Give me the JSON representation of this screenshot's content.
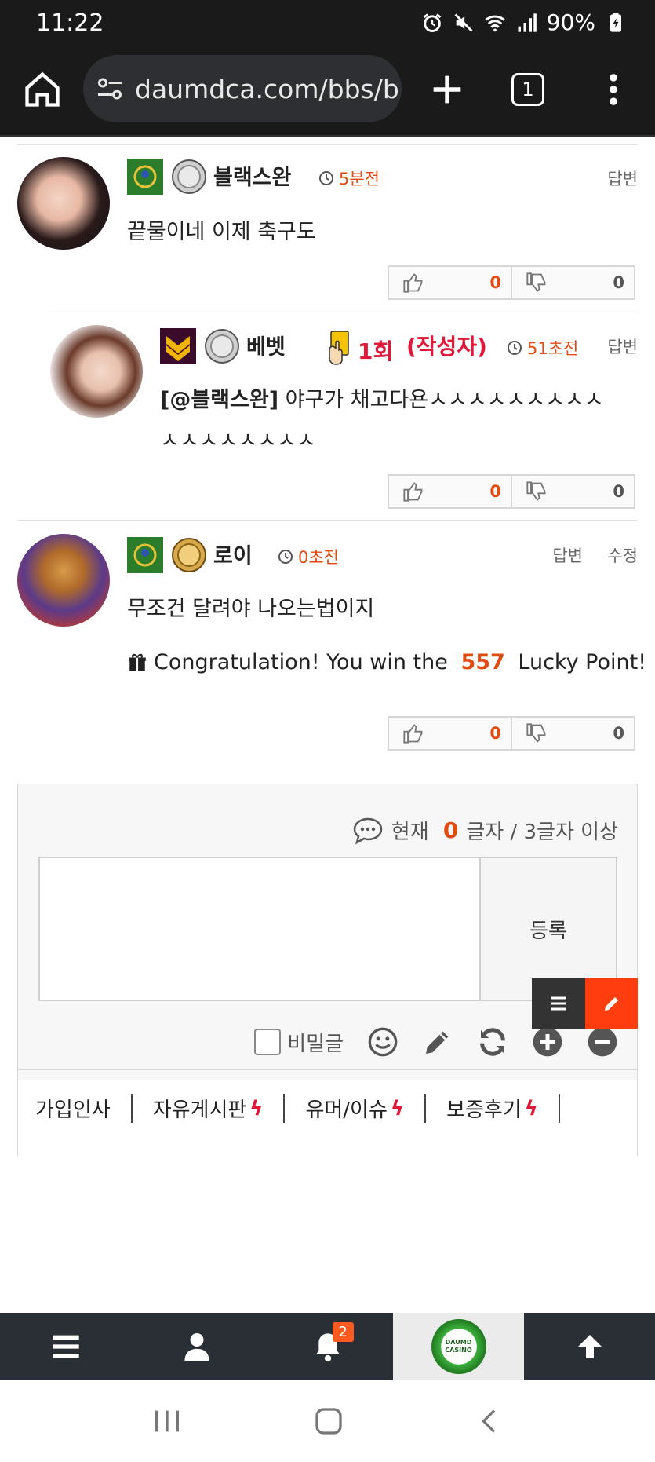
{
  "status_bar": {
    "time": "11:22",
    "battery": "90%"
  },
  "browser": {
    "url": "daumdca.com/bbs/b",
    "tab_count": "1"
  },
  "comments": [
    {
      "nickname": "블랙스완",
      "time_ago": "5분전",
      "text": "끝물이네 이제 축구도",
      "actions": [
        "답변"
      ],
      "likes": "0",
      "dislikes": "0"
    },
    {
      "nickname": "베벳",
      "warning": "1회",
      "author_tag": "(작성자)",
      "time_ago": "51초전",
      "mention": "[@블랙스완]",
      "text_line1": " 야구가 채고다욘ㅅㅅㅅㅅㅅㅅㅅㅅㅅ",
      "text_line2": "ㅅㅅㅅㅅㅅㅅㅅㅅ",
      "actions": [
        "답변"
      ],
      "likes": "0",
      "dislikes": "0"
    },
    {
      "nickname": "로이",
      "time_ago": "0초전",
      "text": "무조건 달려야 나오는법이지",
      "actions": [
        "답변",
        "수정"
      ],
      "lucky_prefix": "Congratulation! You win the ",
      "lucky_points": "557",
      "lucky_suffix": " Lucky Point!",
      "likes": "0",
      "dislikes": "0"
    }
  ],
  "editor": {
    "counter_prefix": "현재 ",
    "counter_value": "0",
    "counter_suffix": "글자 / 3글자 이상",
    "submit_label": "등록",
    "secret_label": "비밀글"
  },
  "categories": [
    {
      "label": "가입인사",
      "bolt": ""
    },
    {
      "label": "자유게시판",
      "bolt": "ϟ"
    },
    {
      "label": "유머/이슈",
      "bolt": "ϟ"
    },
    {
      "label": "보증후기",
      "bolt": "ϟ"
    }
  ],
  "bottom_nav": {
    "notification_count": "2",
    "logo_text": "DAUMD CASINO"
  }
}
